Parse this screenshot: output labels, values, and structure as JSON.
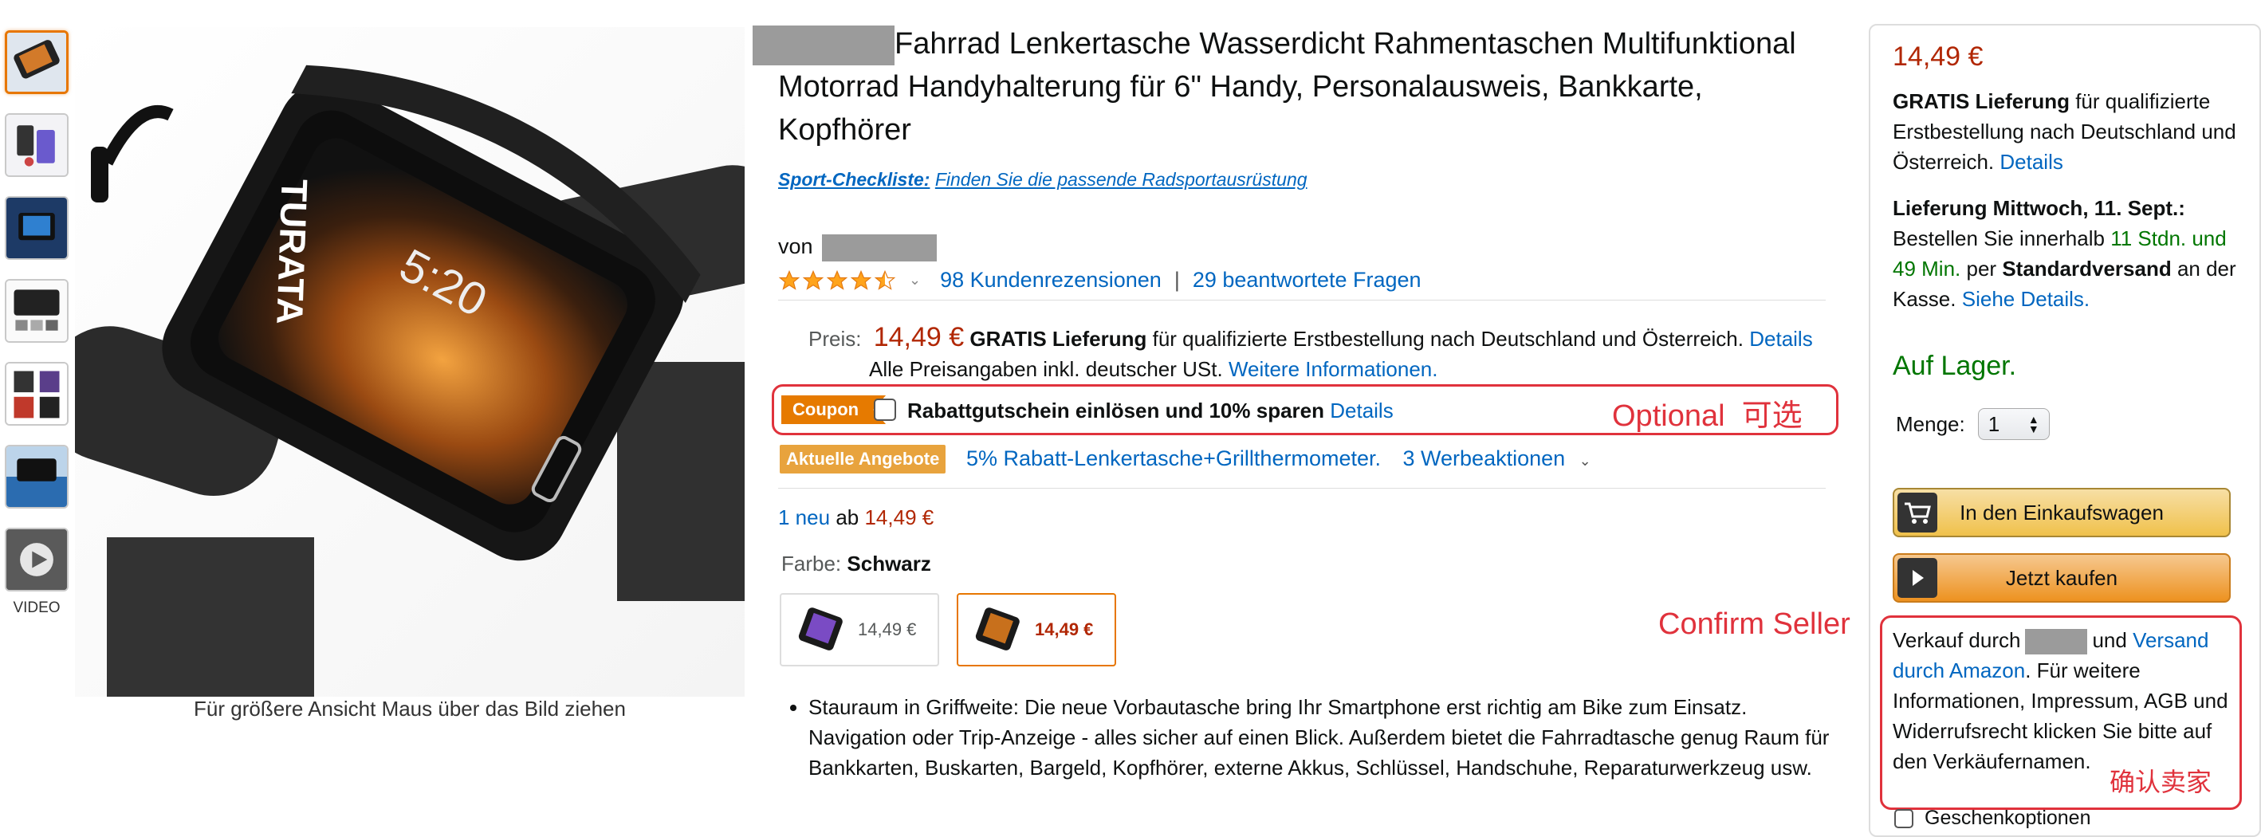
{
  "gallery": {
    "video_label": "VIDEO",
    "hint": "Für größere Ansicht Maus über das Bild ziehen",
    "phone_time": "5:20",
    "brand_print": "TURATA"
  },
  "product": {
    "title": "Fahrrad Lenkertasche Wasserdicht Rahmentaschen Multifunktional Motorrad Handyhalterung für 6\" Handy, Personalausweis, Bankkarte, Kopfhörer",
    "checklist_bold": "Sport-Checkliste:",
    "checklist_text": "Finden Sie die passende Radsportausrüstung",
    "von": "von",
    "rating_value": 4.5,
    "reviews": "98 Kundenrezensionen",
    "separator": "|",
    "questions": "29 beantwortete Fragen"
  },
  "price": {
    "label": "Preis:",
    "amount": "14,49 €",
    "shipping_bold": "GRATIS Lieferung",
    "shipping_text": "für qualifizierte Erstbestellung nach Deutschland und Österreich.",
    "details": "Details",
    "vat_text": "Alle Preisangaben inkl. deutscher USt.",
    "more_info": "Weitere Informationen."
  },
  "coupon": {
    "badge": "Coupon",
    "text": "Rabattgutschein einlösen und 10% sparen",
    "details": "Details",
    "annotation": "Optional  可选"
  },
  "offers": {
    "badge": "Aktuelle Angebote",
    "deal": "5% Rabatt-Lenkertasche+Grillthermometer.",
    "promos": "3 Werbeaktionen"
  },
  "new_offers": {
    "link": "1 neu",
    "ab": "ab",
    "price": "14,49 €"
  },
  "color": {
    "label": "Farbe:",
    "value": "Schwarz",
    "swatches": [
      {
        "price": "14,49 €"
      },
      {
        "price": "14,49 €"
      }
    ]
  },
  "bullets": [
    "Stauraum in Griffweite: Die neue Vorbautasche bring Ihr Smartphone erst richtig am Bike zum Einsatz. Navigation oder Trip-Anzeige - alles sicher auf einen Blick. Außerdem bietet die Fahrradtasche genug Raum für Bankkarten, Buskarten, Bargeld, Kopfhörer, externe Akkus, Schlüssel, Handschuhe, Reparaturwerkzeug usw."
  ],
  "buybox": {
    "price": "14,49 €",
    "shipping_bold": "GRATIS Lieferung",
    "shipping_text": "für qualifizierte Erstbestellung nach Deutschland und Österreich.",
    "details": "Details",
    "delivery_bold": "Lieferung Mittwoch, 11. Sept.:",
    "order_prefix": "Bestellen Sie innerhalb",
    "countdown": "11 Stdn. und 49 Min.",
    "per": "per",
    "standard": "Standardversand",
    "checkout": "an der Kasse.",
    "see_details": "Siehe Details.",
    "stock": "Auf Lager.",
    "qty_label": "Menge:",
    "qty_value": "1",
    "add_to_cart": "In den Einkaufswagen",
    "buy_now": "Jetzt kaufen",
    "confirm_seller": "Confirm Seller",
    "sold_by": "Verkauf durch",
    "und": "und",
    "fulfilled": "Versand durch Amazon",
    "seller_info": ". Für weitere Informationen, Impressum, AGB und Widerrufsrecht klicken Sie bitte auf den Verkäufernamen.",
    "confirm_seller_cn": "确认卖家",
    "gift_options": "Geschenkoptionen"
  },
  "colors": {
    "price_red": "#B12704",
    "link_blue": "#0066C0",
    "stock_green": "#007600",
    "annotation_red": "#e0323c",
    "coupon_orange": "#E67A00"
  }
}
